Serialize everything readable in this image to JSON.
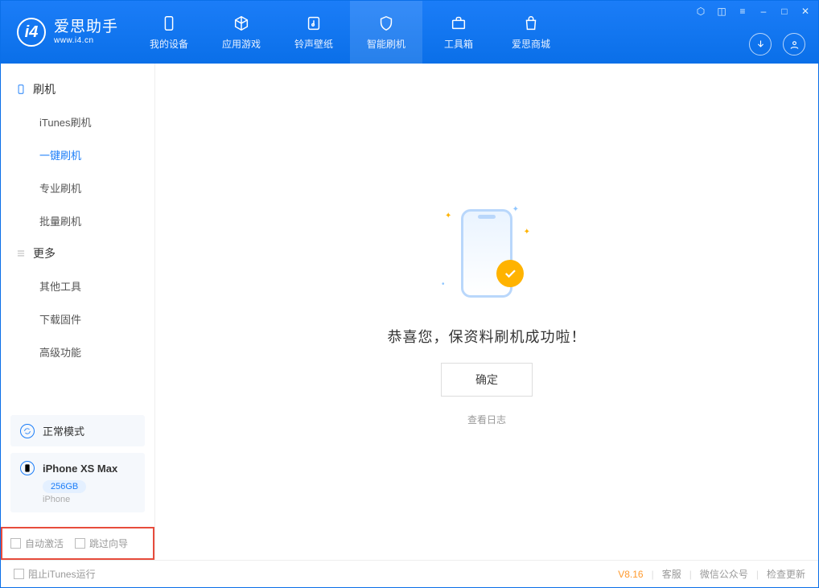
{
  "app": {
    "title": "爱思助手",
    "subtitle": "www.i4.cn"
  },
  "nav": {
    "items": [
      {
        "label": "我的设备"
      },
      {
        "label": "应用游戏"
      },
      {
        "label": "铃声壁纸"
      },
      {
        "label": "智能刷机"
      },
      {
        "label": "工具箱"
      },
      {
        "label": "爱思商城"
      }
    ]
  },
  "sidebar": {
    "group1": {
      "title": "刷机",
      "items": [
        {
          "label": "iTunes刷机"
        },
        {
          "label": "一键刷机"
        },
        {
          "label": "专业刷机"
        },
        {
          "label": "批量刷机"
        }
      ]
    },
    "group2": {
      "title": "更多",
      "items": [
        {
          "label": "其他工具"
        },
        {
          "label": "下载固件"
        },
        {
          "label": "高级功能"
        }
      ]
    },
    "mode_label": "正常模式",
    "device": {
      "name": "iPhone XS Max",
      "storage": "256GB",
      "type": "iPhone"
    },
    "cb_auto_activate": "自动激活",
    "cb_skip_guide": "跳过向导"
  },
  "main": {
    "success_msg": "恭喜您，保资料刷机成功啦！",
    "ok_label": "确定",
    "log_link": "查看日志"
  },
  "footer": {
    "block_itunes": "阻止iTunes运行",
    "version": "V8.16",
    "links": {
      "support": "客服",
      "wechat": "微信公众号",
      "update": "检查更新"
    }
  }
}
